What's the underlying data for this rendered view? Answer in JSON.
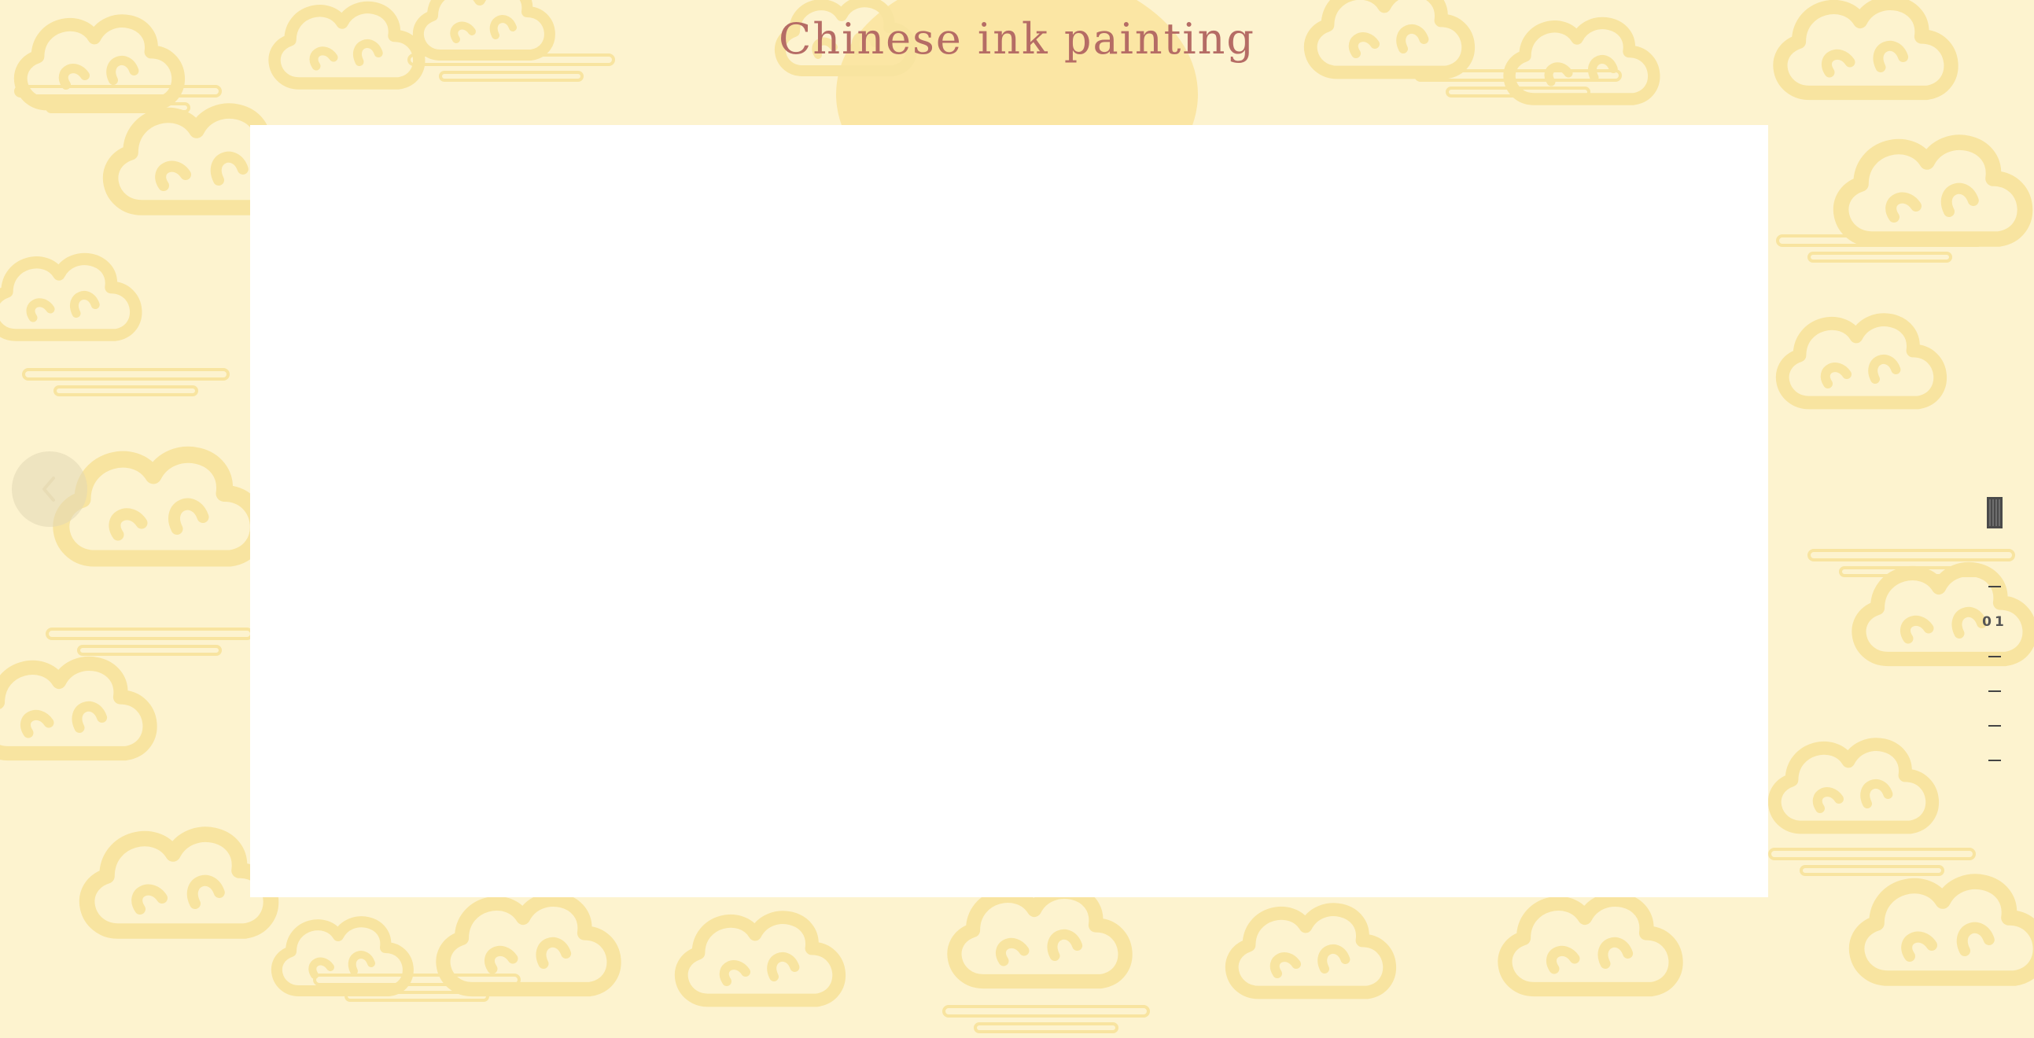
{
  "page": {
    "title": "Chinese ink painting"
  },
  "navigation": {
    "prev_icon": "chevron-left-icon",
    "current_page": "01",
    "page_count": 5,
    "seal_icon": "seal-stamp-icon"
  },
  "colors": {
    "background": "#fdf3cf",
    "cloud_pattern": "#f8e4a0",
    "title": "#b56c65",
    "panel": "#ffffff",
    "pager_text": "#555555"
  }
}
